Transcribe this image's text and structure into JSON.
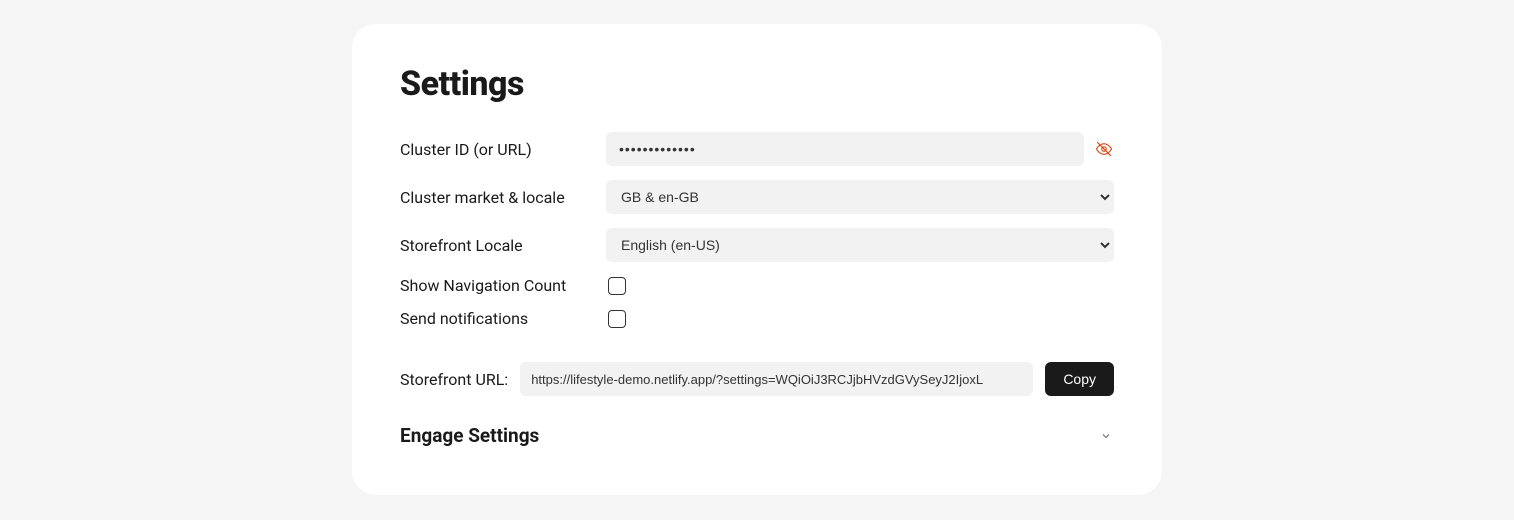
{
  "title": "Settings",
  "fields": {
    "cluster_id": {
      "label": "Cluster ID (or URL)",
      "value": "•••••••••••••"
    },
    "market_locale": {
      "label": "Cluster market & locale",
      "selected": "GB & en-GB"
    },
    "storefront_locale": {
      "label": "Storefront Locale",
      "selected": "English (en-US)"
    },
    "show_nav_count": {
      "label": "Show Navigation Count",
      "checked": false
    },
    "send_notifications": {
      "label": "Send notifications",
      "checked": false
    }
  },
  "storefront_url": {
    "label": "Storefront URL:",
    "value": "https://lifestyle-demo.netlify.app/?settings=WQiOiJ3RCJjbHVzdGVySeyJ2IjoxL",
    "copy_label": "Copy"
  },
  "engage_section": {
    "title": "Engage Settings"
  }
}
